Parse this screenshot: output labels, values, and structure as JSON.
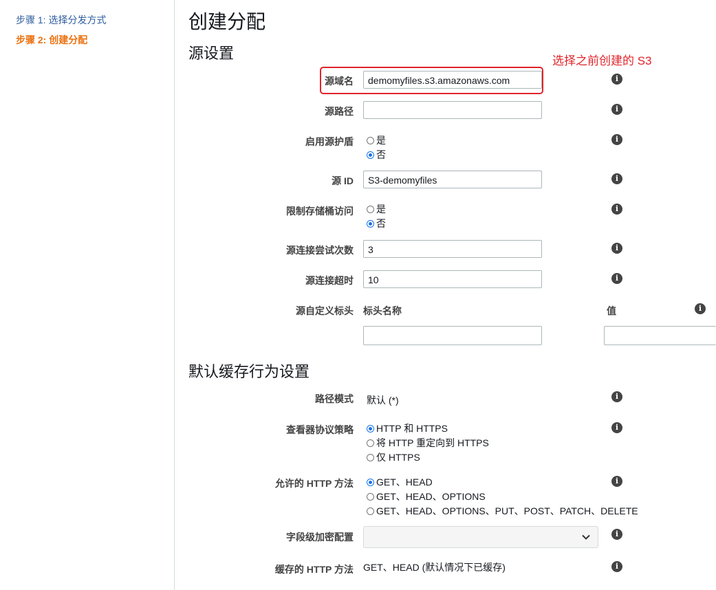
{
  "sidebar": {
    "step1": "步骤 1: 选择分发方式",
    "step2": "步骤 2: 创建分配"
  },
  "page": {
    "title": "创建分配",
    "section_origin": "源设置",
    "section_cache": "默认缓存行为设置",
    "annotation": "选择之前创建的 S3"
  },
  "origin": {
    "domain_label": "源域名",
    "domain_value": "demomyfiles.s3.amazonaws.com",
    "path_label": "源路径",
    "path_value": "",
    "shield_label": "启用源护盾",
    "shield_yes": "是",
    "shield_no": "否",
    "id_label": "源 ID",
    "id_value": "S3-demomyfiles",
    "restrict_label": "限制存储桶访问",
    "restrict_yes": "是",
    "restrict_no": "否",
    "attempts_label": "源连接尝试次数",
    "attempts_value": "3",
    "timeout_label": "源连接超时",
    "timeout_value": "10",
    "headers_label": "源自定义标头",
    "header_name_col": "标头名称",
    "header_value_col": "值"
  },
  "cache": {
    "path_label": "路径模式",
    "path_value": "默认 (*)",
    "viewer_label": "查看器协议策略",
    "viewer_options": [
      "HTTP 和 HTTPS",
      "将 HTTP 重定向到 HTTPS",
      "仅 HTTPS"
    ],
    "methods_label": "允许的 HTTP 方法",
    "methods_options": [
      "GET、HEAD",
      "GET、HEAD、OPTIONS",
      "GET、HEAD、OPTIONS、PUT、POST、PATCH、DELETE"
    ],
    "fle_label": "字段级加密配置",
    "cached_label": "缓存的 HTTP 方法",
    "cached_value": "GET、HEAD (默认情况下已缓存)"
  },
  "icons": {
    "info": "info-icon",
    "select_arrow": "chevron-down-icon"
  },
  "colors": {
    "active_step": "#ec7211",
    "link_step": "#2e5d9f",
    "annotation": "#e0242b",
    "radio_selected": "#1a73e8"
  }
}
